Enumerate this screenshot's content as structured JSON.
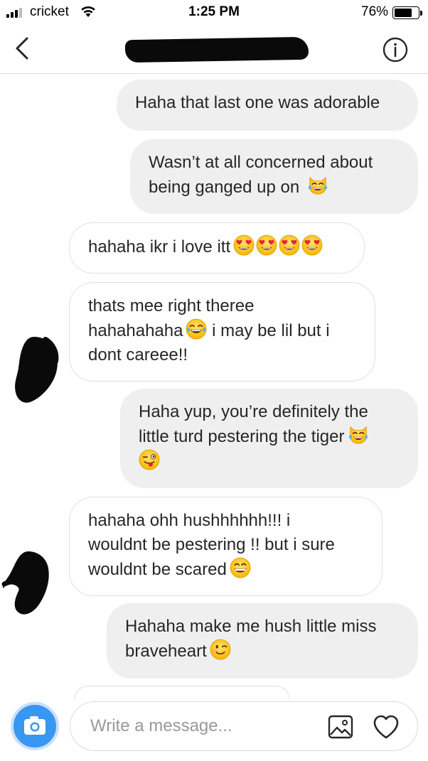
{
  "status_bar": {
    "carrier": "cricket",
    "time": "1:25 PM",
    "battery_percent": "76%",
    "battery_level": 0.76,
    "icons": [
      "signal-icon",
      "wifi-icon",
      "battery-icon"
    ]
  },
  "header": {
    "icons": [
      "chevron-left-icon",
      "info-icon"
    ]
  },
  "messages": [
    {
      "direction": "sent",
      "lines": [
        "Haha that last one was adorable"
      ],
      "emojis": []
    },
    {
      "direction": "sent",
      "lines": [
        "Wasn’t at all concerned about",
        "being ganged up on"
      ],
      "emojis": [
        "cat-tears-of-joy-emoji"
      ]
    },
    {
      "direction": "received",
      "lines": [
        "hahaha ikr i love itt"
      ],
      "emojis": [
        "heart-eyes-emoji",
        "heart-eyes-emoji",
        "heart-eyes-emoji",
        "heart-eyes-emoji"
      ]
    },
    {
      "direction": "received",
      "lines": [
        "thats mee right theree",
        "hahahahaha",
        "i may be lil but i",
        "dont careee!!"
      ],
      "emojis": [
        "tears-of-joy-emoji"
      ]
    },
    {
      "direction": "sent",
      "lines": [
        "Haha yup, you’re definitely the",
        "little turd pestering the tiger"
      ],
      "emojis": [
        "cat-tears-of-joy-emoji",
        "winking-tongue-emoji"
      ]
    },
    {
      "direction": "received",
      "lines": [
        "hahaha ohh hushhhhhh!!! i",
        "wouldnt be pestering !! but i sure",
        "wouldnt be scared"
      ],
      "emojis": [
        "grinning-emoji"
      ]
    },
    {
      "direction": "sent",
      "lines": [
        "Hahaha make me hush little miss",
        "braveheart"
      ],
      "emojis": [
        "winking-emoji"
      ]
    }
  ],
  "composer": {
    "placeholder": "Write a message...",
    "value": "",
    "icons": [
      "camera-icon",
      "gallery-icon",
      "heart-icon"
    ]
  },
  "colors": {
    "sent_bubble": "#efefef",
    "received_border": "#e0e0e0",
    "camera_button": "#3897f0",
    "placeholder_text": "#999999"
  }
}
